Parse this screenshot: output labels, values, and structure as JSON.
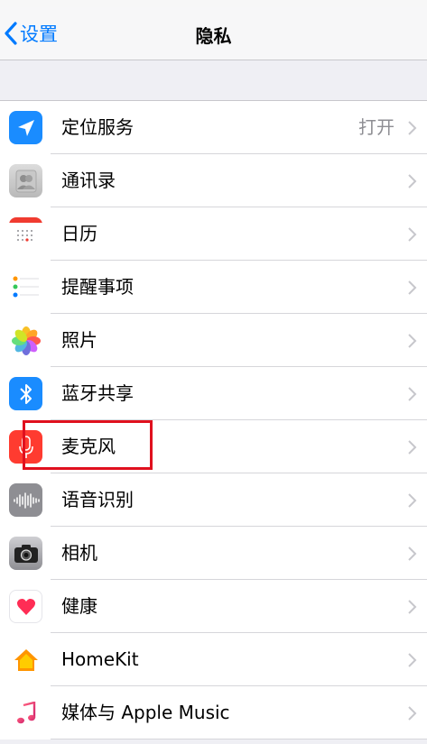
{
  "nav": {
    "back_label": "设置",
    "title": "隐私"
  },
  "rows": [
    {
      "label": "定位服务",
      "value": "打开",
      "icon": "location-arrow-icon"
    },
    {
      "label": "通讯录",
      "icon": "contacts-icon"
    },
    {
      "label": "日历",
      "icon": "calendar-icon"
    },
    {
      "label": "提醒事项",
      "icon": "reminders-icon"
    },
    {
      "label": "照片",
      "icon": "photos-icon"
    },
    {
      "label": "蓝牙共享",
      "icon": "bluetooth-icon"
    },
    {
      "label": "麦克风",
      "icon": "microphone-icon"
    },
    {
      "label": "语音识别",
      "icon": "speech-recognition-icon"
    },
    {
      "label": "相机",
      "icon": "camera-icon"
    },
    {
      "label": "健康",
      "icon": "heart-icon"
    },
    {
      "label": "HomeKit",
      "icon": "homekit-house-icon"
    },
    {
      "label": "媒体与 Apple Music",
      "icon": "music-note-icon"
    }
  ],
  "colors": {
    "ios_blue": "#007aff",
    "highlight_red": "#e0101e"
  }
}
